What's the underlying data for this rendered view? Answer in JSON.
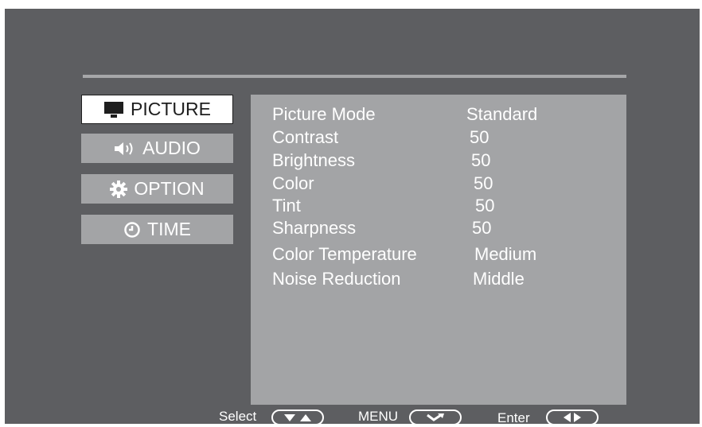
{
  "menu": {
    "items": [
      {
        "label": "PICTURE",
        "icon": "monitor-icon",
        "active": true
      },
      {
        "label": "AUDIO",
        "icon": "speaker-icon",
        "active": false
      },
      {
        "label": "OPTION",
        "icon": "gear-icon",
        "active": false
      },
      {
        "label": "TIME",
        "icon": "clock-icon",
        "active": false
      }
    ]
  },
  "settings": [
    {
      "label": "Picture Mode",
      "value": "Standard"
    },
    {
      "label": "Contrast",
      "value": "50"
    },
    {
      "label": "Brightness",
      "value": "50"
    },
    {
      "label": "Color",
      "value": "50"
    },
    {
      "label": "Tint",
      "value": "50"
    },
    {
      "label": "Sharpness",
      "value": "50"
    },
    {
      "label": "Color Temperature",
      "value": "Medium"
    },
    {
      "label": "Noise Reduction",
      "value": "Middle"
    }
  ],
  "footer": {
    "select_label": "Select",
    "menu_label": "MENU",
    "enter_label": "Enter"
  },
  "colors": {
    "background": "#5d5e61",
    "panel": "#a3a4a6",
    "active_tab": "#ffffff",
    "text": "#ffffff"
  }
}
